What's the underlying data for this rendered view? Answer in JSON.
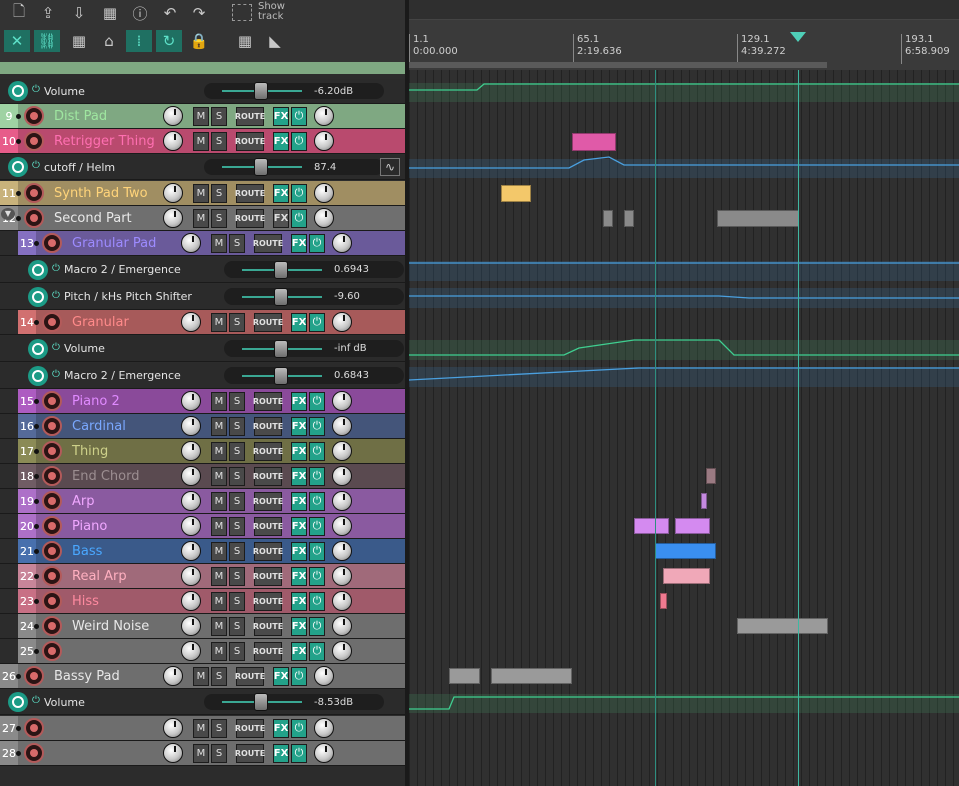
{
  "toolbar": {
    "row1": [
      "new-file-icon",
      "save-icon",
      "import-icon",
      "undo-history-icon",
      "info-icon",
      "undo-icon",
      "redo-icon",
      "metronome-icon"
    ],
    "row2": [
      "ripple-edit-icon",
      "link-icon",
      "grid-icon",
      "grouping-icon",
      "snap-icon",
      "loop-icon",
      "lock-icon"
    ],
    "show_track_label": "Show track"
  },
  "ruler": {
    "markers": [
      {
        "bar": "1.1",
        "time": "0:00.000"
      },
      {
        "bar": "65.1",
        "time": "2:19.636"
      },
      {
        "bar": "129.1",
        "time": "4:39.272"
      },
      {
        "bar": "193.1",
        "time": "6:58.909"
      }
    ]
  },
  "tracks": [
    {
      "num": "9",
      "name": "Dist Pad",
      "color": "#7fa882",
      "text": "#9fe6a0",
      "fx": "on"
    },
    {
      "num": "10",
      "name": "Retrigger Thing",
      "color": "#b94a6e",
      "text": "#ff6fb1",
      "fx": "on"
    },
    {
      "num": "11",
      "name": "Synth Pad Two",
      "color": "#a08e62",
      "text": "#ffd47a",
      "fx": "on"
    },
    {
      "num": "12",
      "name": "Second Part",
      "color": "#6f6f6f",
      "text": "#e8e8e8",
      "fx": "off"
    },
    {
      "num": "13",
      "name": "Granular Pad",
      "color": "#6a5a9a",
      "text": "#9d8bff",
      "fx": "on"
    },
    {
      "num": "14",
      "name": "Granular",
      "color": "#a75a5a",
      "text": "#ff8a8a",
      "fx": "on"
    },
    {
      "num": "15",
      "name": "Piano 2",
      "color": "#8a4a9a",
      "text": "#e08aff",
      "fx": "on"
    },
    {
      "num": "16",
      "name": "Cardinal",
      "color": "#44557a",
      "text": "#7aa8ff",
      "fx": "on"
    },
    {
      "num": "17",
      "name": "Thing",
      "color": "#6f6f45",
      "text": "#ced18a",
      "fx": "on"
    },
    {
      "num": "18",
      "name": "End Chord",
      "color": "#5a4a50",
      "text": "#9c8e91",
      "fx": "on"
    },
    {
      "num": "19",
      "name": "Arp",
      "color": "#8a5aa0",
      "text": "#f0a8ff",
      "fx": "on"
    },
    {
      "num": "20",
      "name": "Piano",
      "color": "#8a5aa0",
      "text": "#f0a8ff",
      "fx": "on"
    },
    {
      "num": "21",
      "name": "Bass",
      "color": "#3a5a8a",
      "text": "#4aa8ff",
      "fx": "on"
    },
    {
      "num": "22",
      "name": "Real Arp",
      "color": "#a06a7a",
      "text": "#ffb0c0",
      "fx": "on"
    },
    {
      "num": "23",
      "name": "Hiss",
      "color": "#a05a6a",
      "text": "#ff8aa0",
      "fx": "on"
    },
    {
      "num": "24",
      "name": "Weird Noise",
      "color": "#6e6e6e",
      "text": "#e8e8e8",
      "fx": "on"
    },
    {
      "num": "25",
      "name": "",
      "color": "#6e6e6e",
      "text": "#e8e8e8",
      "fx": "on"
    },
    {
      "num": "26",
      "name": "Bassy Pad",
      "color": "#6e6e6e",
      "text": "#e8e8e8",
      "fx": "on"
    },
    {
      "num": "27",
      "name": "",
      "color": "#6e6e6e",
      "text": "#e8e8e8",
      "fx": "on"
    },
    {
      "num": "28",
      "name": "",
      "color": "#6e6e6e",
      "text": "#e8e8e8",
      "fx": "on"
    }
  ],
  "envelopes": [
    {
      "name": "Volume",
      "value": "-6.20dB"
    },
    {
      "name": "cutoff / Helm",
      "value": "87.4"
    },
    {
      "name": "Macro 2 / Emergence",
      "value": "0.6943"
    },
    {
      "name": "Pitch / kHs Pitch Shifter",
      "value": "-9.60"
    },
    {
      "name": "Volume",
      "value": "-inf dB"
    },
    {
      "name": "Macro 2 / Emergence",
      "value": "0.6843"
    },
    {
      "name": "Volume",
      "value": "-8.53dB"
    }
  ],
  "button_labels": {
    "mute": "M",
    "solo": "S",
    "route": "ROUTE",
    "fx": "FX",
    "power": "⏻"
  }
}
